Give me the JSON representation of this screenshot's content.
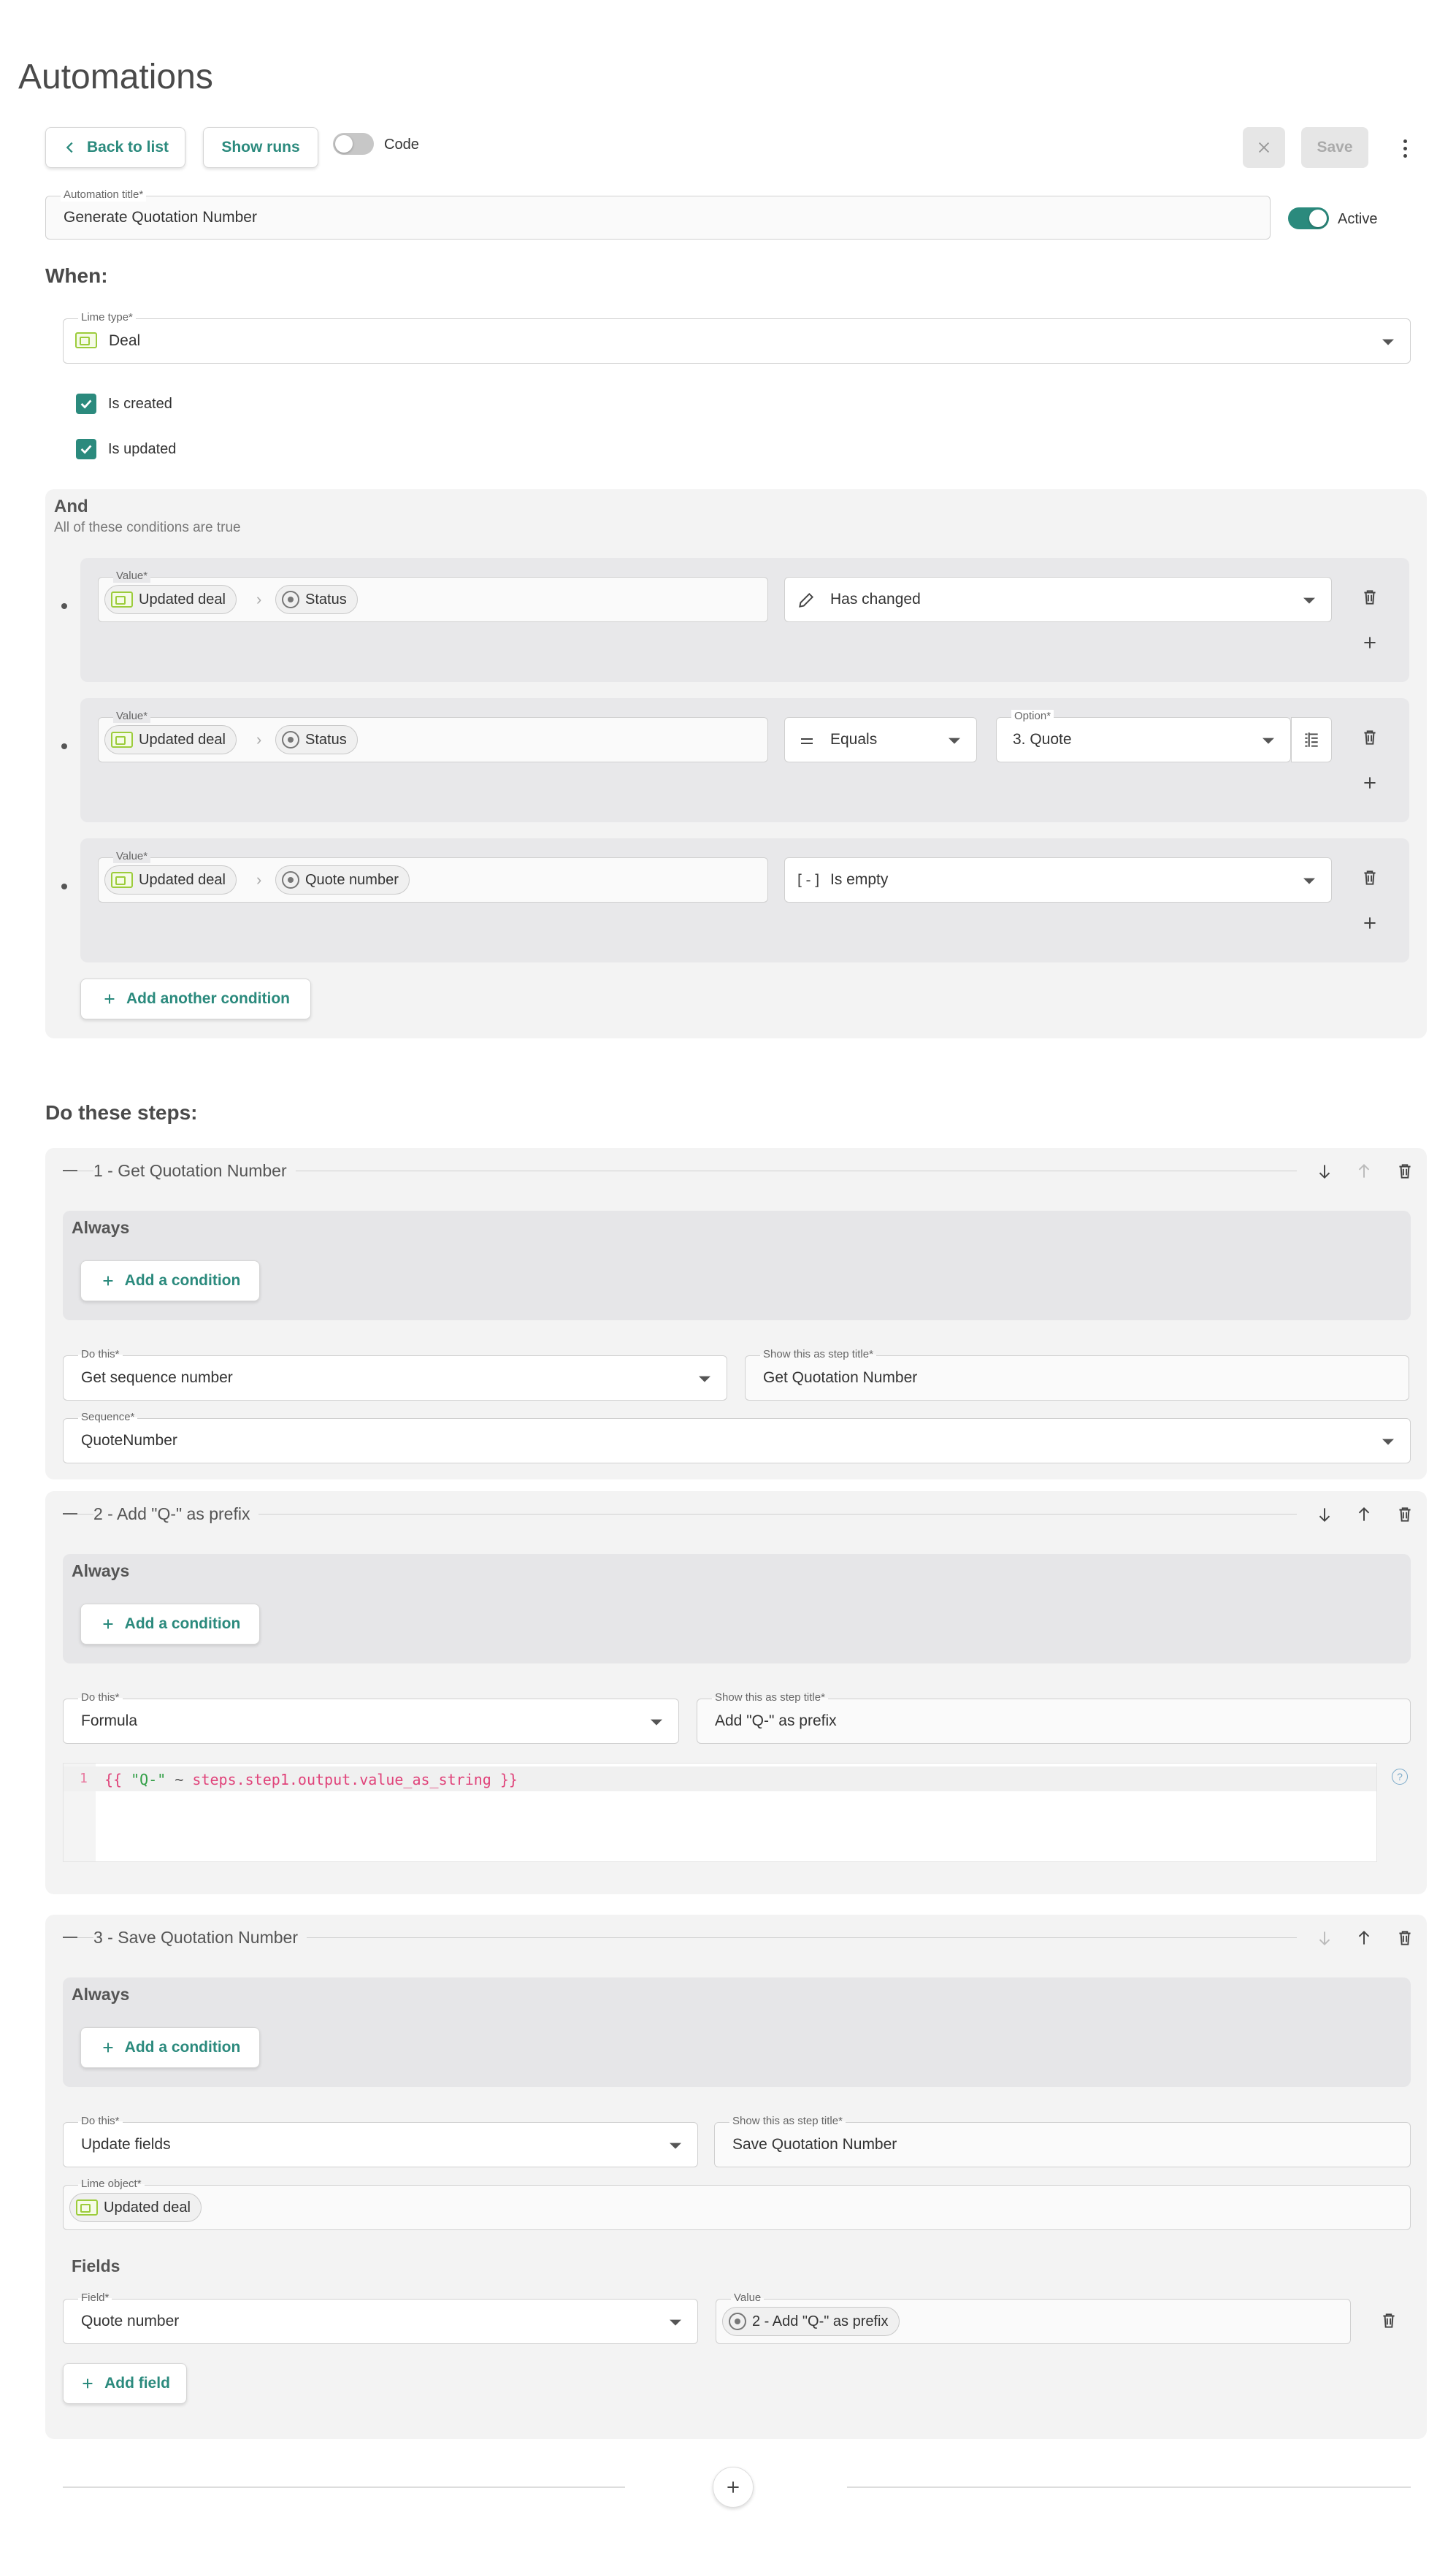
{
  "page": {
    "title": "Automations"
  },
  "toolbar": {
    "back_label": "Back to list",
    "show_runs_label": "Show runs",
    "code_label": "Code",
    "save_label": "Save"
  },
  "automation": {
    "title_label": "Automation title*",
    "title_value": "Generate Quotation Number",
    "active_label": "Active"
  },
  "when": {
    "heading": "When:",
    "limetype_label": "Lime type*",
    "limetype_value": "Deal",
    "triggers": [
      {
        "label": "Is created",
        "checked": true
      },
      {
        "label": "Is updated",
        "checked": true
      }
    ]
  },
  "and": {
    "heading": "And",
    "subheading": "All of these conditions are true",
    "value_label": "Value*",
    "conditions": [
      {
        "object": "Updated deal",
        "field": "Status",
        "operator": "Has changed"
      },
      {
        "object": "Updated deal",
        "field": "Status",
        "operator": "Equals",
        "option_label": "Option*",
        "option_value": "3. Quote"
      },
      {
        "object": "Updated deal",
        "field": "Quote number",
        "operator": "Is empty"
      }
    ],
    "add_condition_label": "Add another condition"
  },
  "steps": {
    "heading": "Do these steps:",
    "do_this_label": "Do this*",
    "step_title_label": "Show this as step title*",
    "always_label": "Always",
    "add_condition_label": "Add a condition",
    "items": [
      {
        "header": "1 - Get Quotation Number",
        "action": "Get sequence number",
        "title": "Get Quotation Number",
        "sequence_label": "Sequence*",
        "sequence_value": "QuoteNumber"
      },
      {
        "header": "2 - Add \"Q-\" as prefix",
        "action": "Formula",
        "title": "Add \"Q-\" as prefix",
        "code_line_no": "1",
        "code_open": "{{ ",
        "code_string": "\"Q-\"",
        "code_op": " ~ ",
        "code_expr": "steps.step1.output.value_as_string",
        "code_close": " }}",
        "help": "?"
      },
      {
        "header": "3 - Save Quotation Number",
        "action": "Update fields",
        "title": "Save Quotation Number",
        "lime_object_label": "Lime object*",
        "lime_object_value": "Updated deal",
        "fields_heading": "Fields",
        "field_label": "Field*",
        "field_value": "Quote number",
        "value_label": "Value",
        "value_chip": "2 - Add \"Q-\" as prefix",
        "add_field_label": "Add field"
      }
    ]
  },
  "colors": {
    "accent": "#2b8a7d",
    "lime": "#9ccc3b",
    "panel": "#f3f3f3",
    "danger_text": "#e0437a"
  }
}
